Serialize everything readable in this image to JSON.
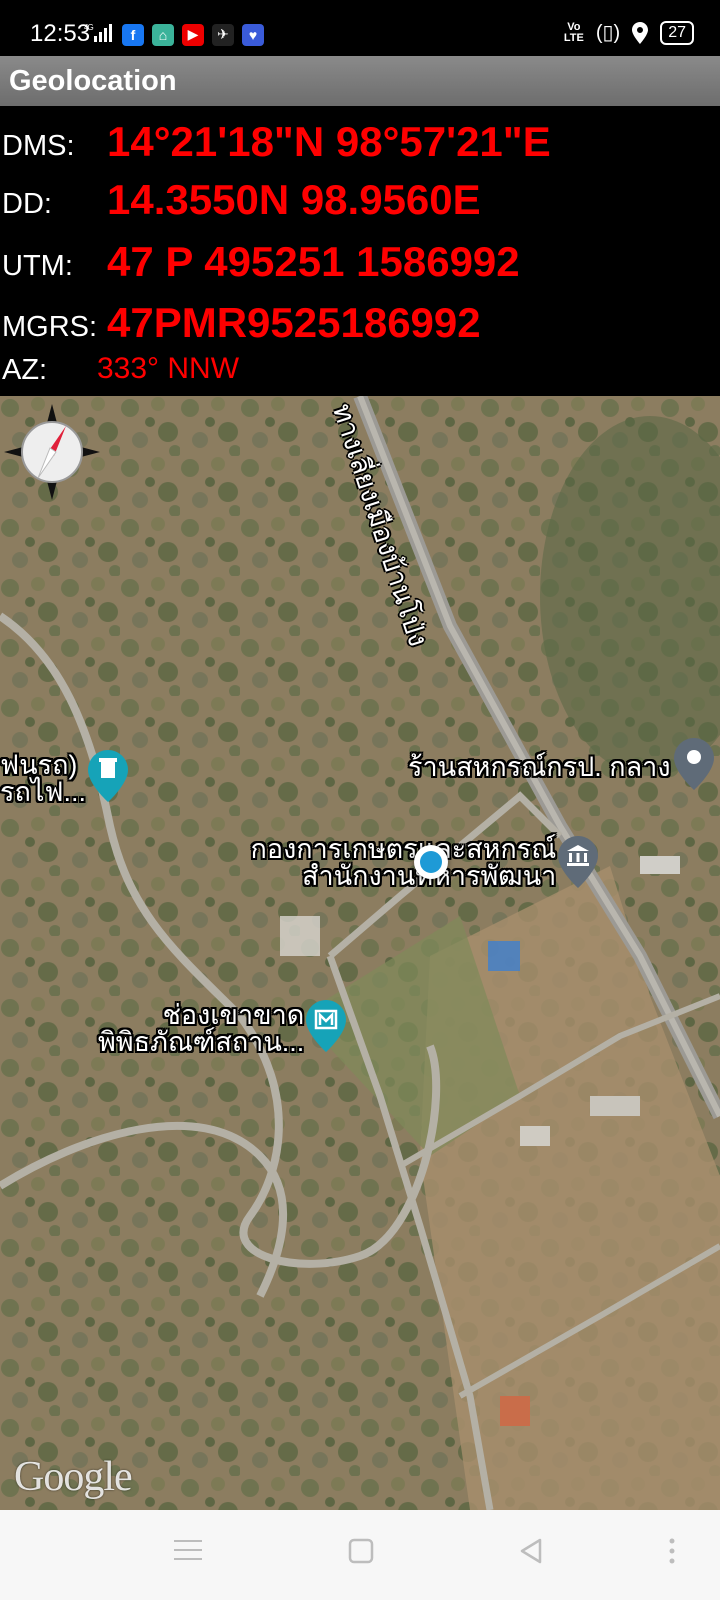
{
  "status_bar": {
    "time": "12:53",
    "network": "4G",
    "left_icons": [
      "signal-icon",
      "facebook-icon",
      "app-icon",
      "youtube-icon",
      "game-icon",
      "app-icon-2"
    ],
    "right_icons": [
      "volte-icon",
      "vibrate-icon",
      "location-icon",
      "battery-icon"
    ],
    "volte_top": "Vo",
    "volte_bottom": "LTE",
    "battery": "27"
  },
  "app": {
    "title": "Geolocation"
  },
  "coords": {
    "dms_label": "DMS:",
    "dms_value": "14°21'18\"N 98°57'21\"E",
    "dd_label": "DD:",
    "dd_value": "14.3550N 98.9560E",
    "utm_label": "UTM:",
    "utm_value": "47 P 495251 1586992",
    "mgrs_label": "MGRS:",
    "mgrs_value": "47PMR9525186992",
    "az_label": "AZ:",
    "az_value": "333° NNW"
  },
  "map": {
    "road_label": "ทางเลี่ยงเมืองบ้านโป่ง",
    "place_1_line1": "ฟนรถ)",
    "place_1_line2": "รถไฟ...",
    "place_2": "ร้านสหกรณ์กรป. กลาง",
    "place_3_line1": "กองการเกษตรและสหกรณ์",
    "place_3_line2": "สำนักงานทหารพัฒนา",
    "place_4_line1": "ช่องเขาขาด",
    "place_4_line2": "พิพิธภัณฑ์สถาน...",
    "attribution": "Google"
  },
  "colors": {
    "value_red": "#ff0000",
    "title_bar": "#7a7a7a",
    "pin_teal": "#16a3b8",
    "pin_gray": "#5f6b78",
    "location_blue": "#1e9ad6"
  }
}
